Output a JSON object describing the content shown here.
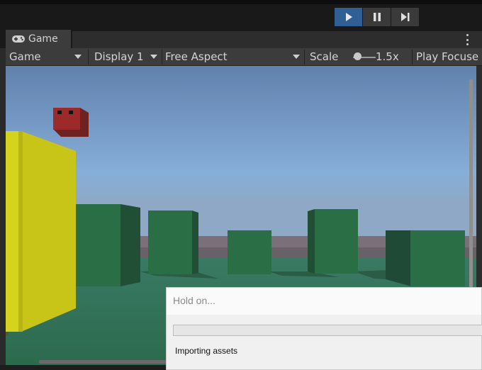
{
  "playmode": {
    "play_icon": "play-icon",
    "pause_icon": "pause-icon",
    "step_icon": "step-icon",
    "active_color": "#2f5f94"
  },
  "tab": {
    "icon": "gamepad-icon",
    "title": "Game",
    "menu_icon": "kebab-menu-icon"
  },
  "gamebar": {
    "view_mode": "Game",
    "display": "Display 1",
    "aspect": "Free Aspect",
    "scale_label": "Scale",
    "scale_value": "1.5x",
    "play_focused": "Play Focuse"
  },
  "dialog": {
    "title": "Hold on...",
    "progress": 0,
    "status": "Importing assets"
  },
  "scene": {
    "sky_top": "#6281ad",
    "sky_bottom": "#85aed8",
    "ground": "#2d6b4f",
    "cube_color": "#2a6e45",
    "player_color": "#c9c418",
    "enemy_color": "#9d2a2a"
  }
}
